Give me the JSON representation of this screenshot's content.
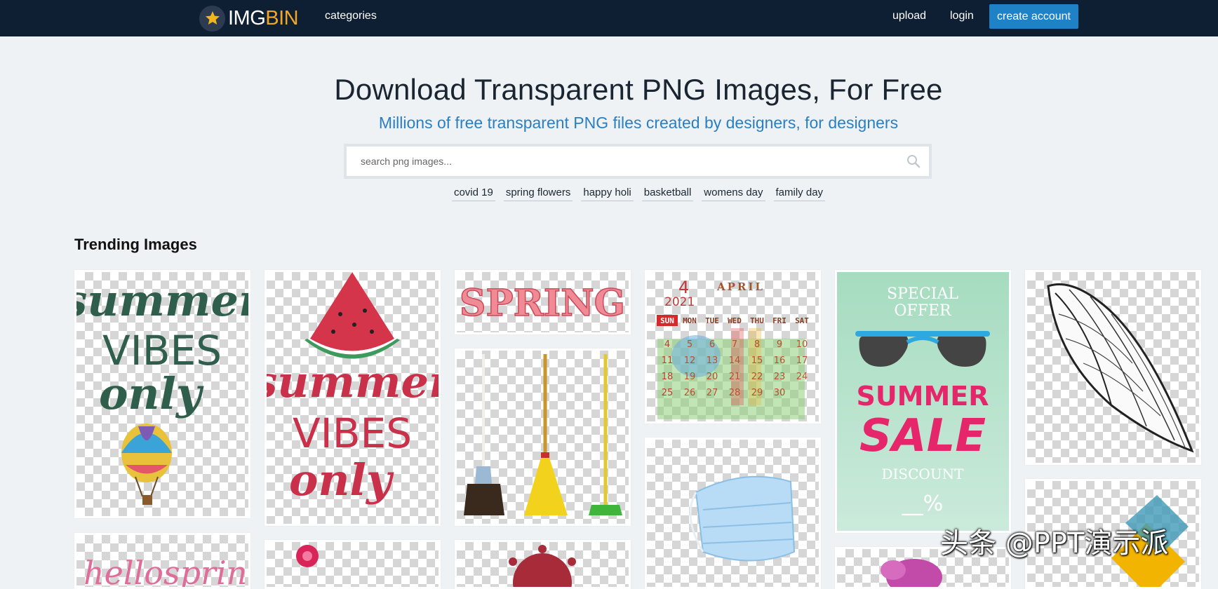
{
  "nav": {
    "logo_img": "IMG",
    "logo_bin": "BIN",
    "categories": "categories",
    "upload": "upload",
    "login": "login",
    "create_account": "create account"
  },
  "hero": {
    "title": "Download Transparent PNG Images, For Free",
    "subtitle": "Millions of free transparent PNG files created by designers, for designers"
  },
  "search": {
    "placeholder": "search png images..."
  },
  "tags": [
    "covid 19",
    "spring flowers",
    "happy holi",
    "basketball",
    "womens day",
    "family day"
  ],
  "section": {
    "title": "Trending Images"
  },
  "cards": {
    "summer_green": {
      "line1": "summer",
      "line2": "VIBES",
      "line3": "only"
    },
    "summer_red": {
      "line1": "summer",
      "line2": "VIBES",
      "line3": "only"
    },
    "spring": {
      "text": "SPRING"
    },
    "calendar": {
      "month_num": "4",
      "year": "2021",
      "month": "APRIL",
      "days": [
        "SUN",
        "MON",
        "TUE",
        "WED",
        "THU",
        "FRI",
        "SAT"
      ],
      "dates": [
        "4",
        "5",
        "6",
        "7",
        "8",
        "9",
        "10",
        "11",
        "12",
        "13",
        "14",
        "15",
        "16",
        "17",
        "18",
        "19",
        "20",
        "21",
        "22",
        "23",
        "24",
        "25",
        "26",
        "27",
        "28",
        "29",
        "30"
      ]
    },
    "sale": {
      "special": "SPECIAL",
      "offer": "OFFER",
      "summer": "SUMMER",
      "sale": "SALE",
      "discount": "DISCOUNT",
      "percent": "__%"
    },
    "hello_spring": {
      "text": "hellospring"
    }
  },
  "watermark": "头条 @PPT演示派",
  "colors": {
    "nav_bg": "#0e1f33",
    "accent": "#1f82c7",
    "logo_bin": "#f2a624",
    "subtitle": "#2a7fc3"
  }
}
